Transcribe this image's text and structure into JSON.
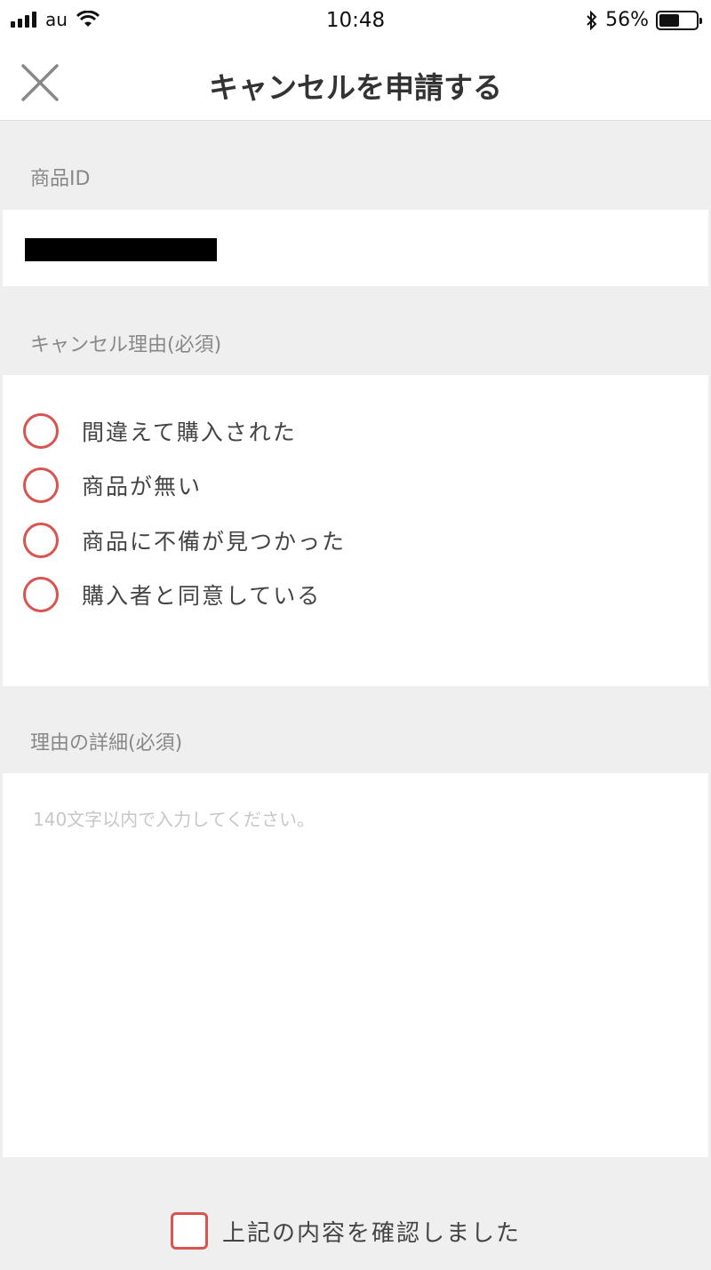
{
  "status_bar": {
    "carrier": "au",
    "time": "10:48",
    "battery_text": "56%",
    "battery_level": 0.56,
    "icons": [
      "signal-icon",
      "wifi-icon",
      "bluetooth-icon",
      "battery-icon"
    ]
  },
  "header": {
    "title": "キャンセルを申請する",
    "close_icon": "close-icon"
  },
  "product_id": {
    "label": "商品ID"
  },
  "cancel_reason": {
    "label": "キャンセル理由(必須)",
    "options": [
      "間違えて購入された",
      "商品が無い",
      "商品に不備が見つかった",
      "購入者と同意している"
    ]
  },
  "reason_detail": {
    "label": "理由の詳細(必須)",
    "placeholder": "140文字以内で入力してください。",
    "value": ""
  },
  "confirm": {
    "label": "上記の内容を確認しました",
    "checked": false
  },
  "colors": {
    "accent": "#d9534f",
    "background": "#efefef",
    "panel": "#ffffff"
  }
}
